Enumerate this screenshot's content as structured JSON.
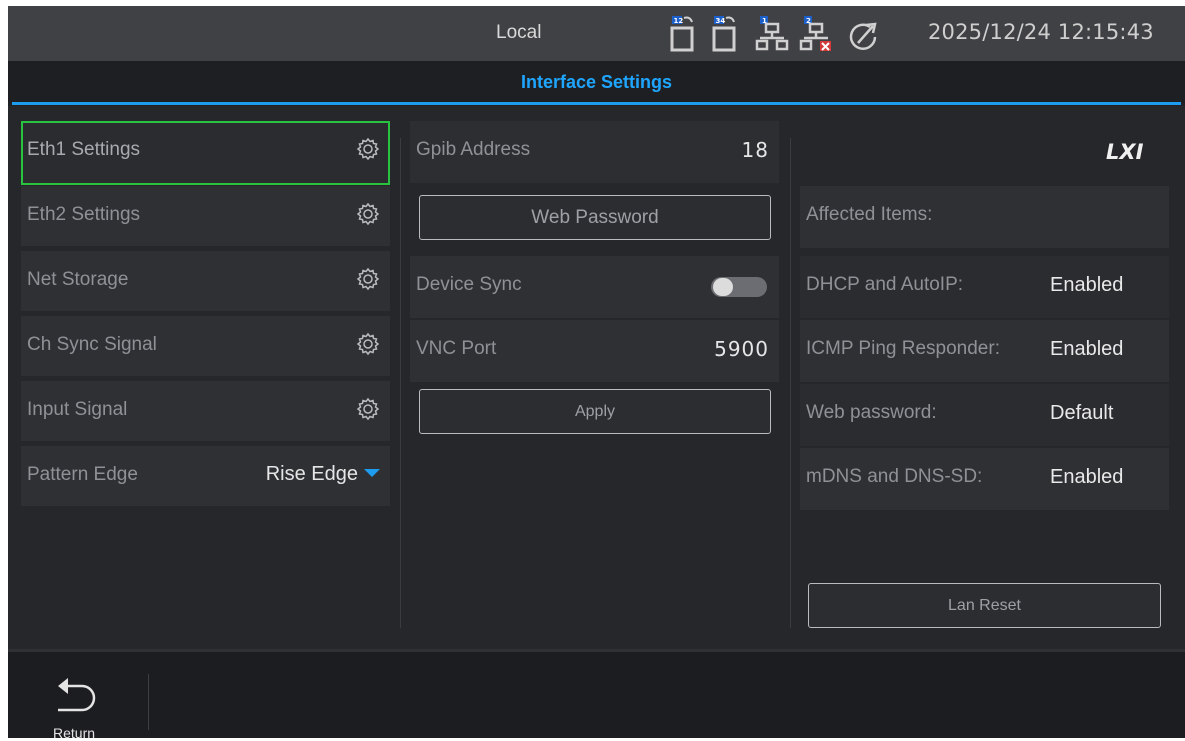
{
  "status": {
    "mode": "Local",
    "datetime": "2025/12/24 12:15:43",
    "icons": [
      "channel-12-icon",
      "channel-34-icon",
      "lan1-icon",
      "lan2-disconnected-icon",
      "sync-icon"
    ]
  },
  "title": "Interface Settings",
  "left_menu": {
    "items": [
      {
        "label": "Eth1 Settings"
      },
      {
        "label": "Eth2 Settings"
      },
      {
        "label": "Net Storage"
      },
      {
        "label": "Ch Sync Signal"
      },
      {
        "label": "Input Signal"
      }
    ],
    "pattern_edge": {
      "label": "Pattern Edge",
      "value": "Rise Edge"
    }
  },
  "middle": {
    "gpib": {
      "label": "Gpib Address",
      "value": "18"
    },
    "web_password_button": "Web Password",
    "device_sync": {
      "label": "Device Sync",
      "enabled": false
    },
    "vnc": {
      "label": "VNC Port",
      "value": "5900"
    },
    "apply_button": "Apply"
  },
  "right": {
    "logo": "LXI",
    "affected_title": "Affected Items:",
    "rows": [
      {
        "label": "DHCP and AutoIP:",
        "value": "Enabled"
      },
      {
        "label": "ICMP Ping Responder:",
        "value": "Enabled"
      },
      {
        "label": "Web password:",
        "value": "Default"
      },
      {
        "label": "mDNS and DNS-SD:",
        "value": "Enabled"
      }
    ],
    "lan_reset_button": "Lan Reset"
  },
  "bottom": {
    "return_label": "Return"
  },
  "colors": {
    "accent": "#1e9cf0",
    "selected_border": "#29c33f",
    "background": "#25272b"
  }
}
